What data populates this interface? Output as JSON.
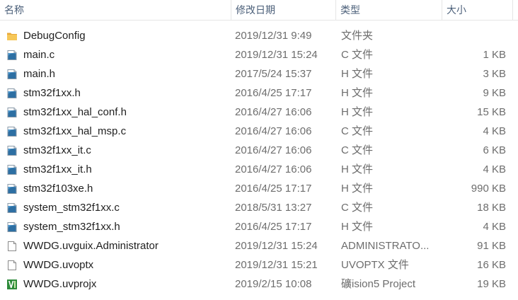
{
  "header": {
    "columns": {
      "name": "名称",
      "date": "修改日期",
      "type": "类型",
      "size": "大小"
    }
  },
  "colors": {
    "header_text": "#4c607a",
    "secondary_text": "#6d6d6d",
    "folder": "#f3c04b",
    "c_file": "#3a8fc7",
    "keil": "#2e8b3a"
  },
  "files": [
    {
      "name": "DebugConfig",
      "date": "2019/12/31 9:49",
      "type": "文件夹",
      "size": "",
      "icon": "folder-icon"
    },
    {
      "name": "main.c",
      "date": "2019/12/31 15:24",
      "type": "C 文件",
      "size": "1 KB",
      "icon": "c-source-file-icon"
    },
    {
      "name": "main.h",
      "date": "2017/5/24 15:37",
      "type": "H 文件",
      "size": "3 KB",
      "icon": "c-source-file-icon"
    },
    {
      "name": "stm32f1xx.h",
      "date": "2016/4/25 17:17",
      "type": "H 文件",
      "size": "9 KB",
      "icon": "c-source-file-icon"
    },
    {
      "name": "stm32f1xx_hal_conf.h",
      "date": "2016/4/27 16:06",
      "type": "H 文件",
      "size": "15 KB",
      "icon": "c-source-file-icon"
    },
    {
      "name": "stm32f1xx_hal_msp.c",
      "date": "2016/4/27 16:06",
      "type": "C 文件",
      "size": "4 KB",
      "icon": "c-source-file-icon"
    },
    {
      "name": "stm32f1xx_it.c",
      "date": "2016/4/27 16:06",
      "type": "C 文件",
      "size": "6 KB",
      "icon": "c-source-file-icon"
    },
    {
      "name": "stm32f1xx_it.h",
      "date": "2016/4/27 16:06",
      "type": "H 文件",
      "size": "4 KB",
      "icon": "c-source-file-icon"
    },
    {
      "name": "stm32f103xe.h",
      "date": "2016/4/25 17:17",
      "type": "H 文件",
      "size": "990 KB",
      "icon": "c-source-file-icon"
    },
    {
      "name": "system_stm32f1xx.c",
      "date": "2018/5/31 13:27",
      "type": "C 文件",
      "size": "18 KB",
      "icon": "c-source-file-icon"
    },
    {
      "name": "system_stm32f1xx.h",
      "date": "2016/4/25 17:17",
      "type": "H 文件",
      "size": "4 KB",
      "icon": "c-source-file-icon"
    },
    {
      "name": "WWDG.uvguix.Administrator",
      "date": "2019/12/31 15:24",
      "type": "ADMINISTRATO...",
      "size": "91 KB",
      "icon": "blank-file-icon"
    },
    {
      "name": "WWDG.uvoptx",
      "date": "2019/12/31 15:21",
      "type": "UVOPTX 文件",
      "size": "16 KB",
      "icon": "blank-file-icon"
    },
    {
      "name": "WWDG.uvprojx",
      "date": "2019/2/15 10:08",
      "type": "礦ision5 Project",
      "size": "19 KB",
      "icon": "keil-project-icon"
    }
  ]
}
